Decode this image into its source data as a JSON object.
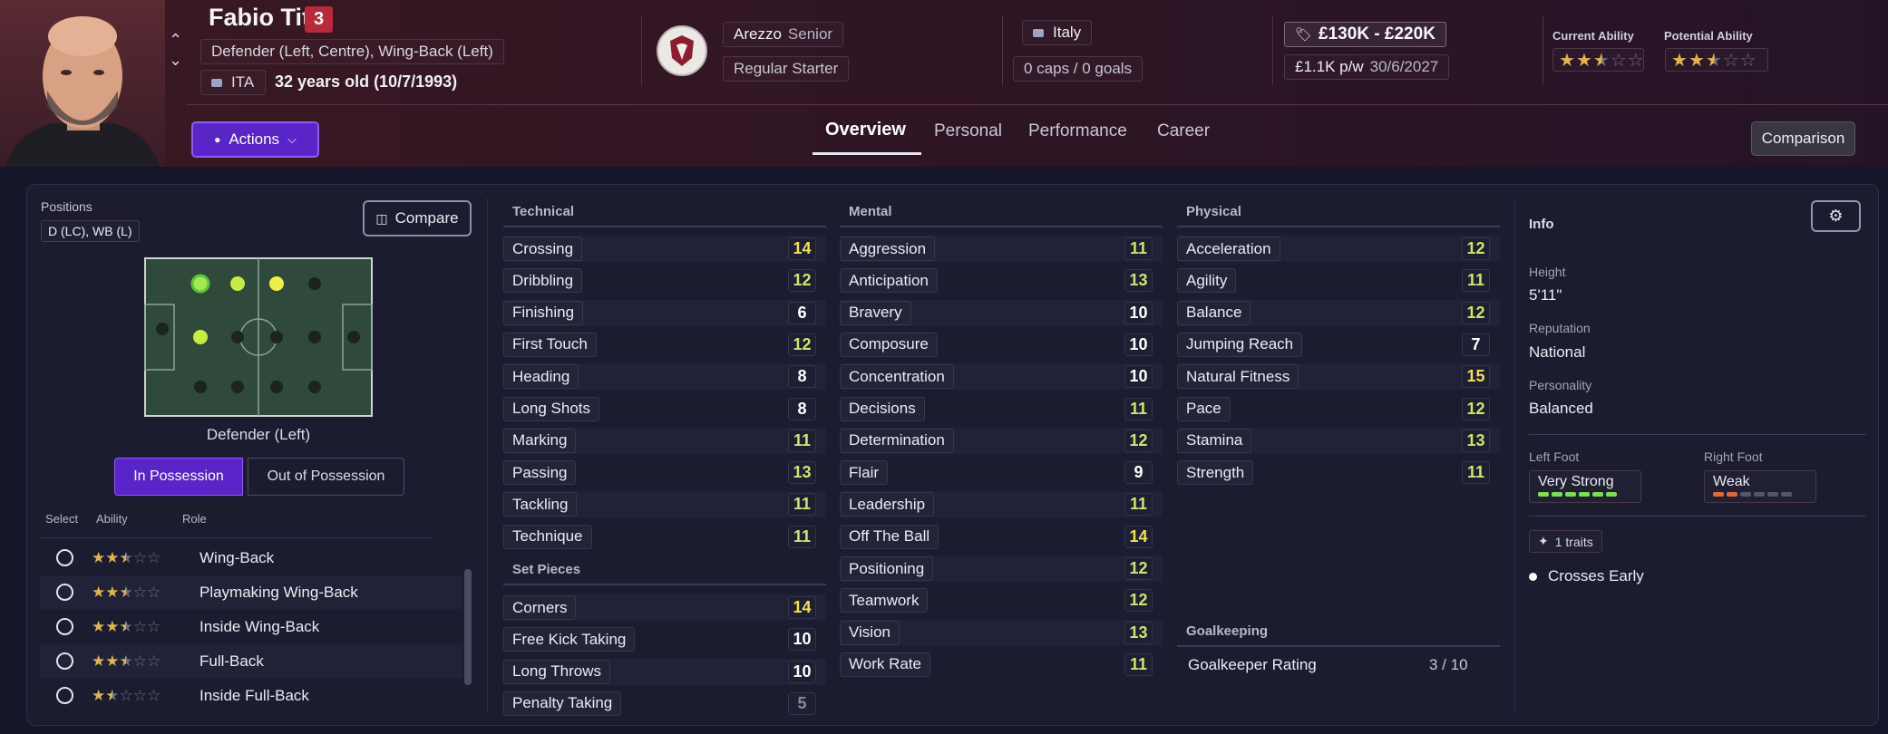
{
  "player": {
    "name": "Fabio Tito",
    "number": "3",
    "positions_text": "Defender (Left, Centre), Wing-Back (Left)",
    "nationality_code": "ITA",
    "age_text": "32 years old (10/7/1993)"
  },
  "club": {
    "name": "Arezzo",
    "squad": "Senior",
    "status": "Regular Starter",
    "badge_text": "S.S. AREZZO 1923"
  },
  "country": {
    "name": "Italy",
    "caps_text": "0 caps / 0 goals"
  },
  "value": {
    "range": "£130K - £220K",
    "wage": "£1.1K p/w",
    "contract_end": "30/6/2027"
  },
  "ability": {
    "current_label": "Current Ability",
    "current_stars": 2.5,
    "potential_label": "Potential Ability",
    "potential_stars": 2.5
  },
  "nav": {
    "actions_label": "Actions",
    "tabs": [
      "Overview",
      "Personal",
      "Performance",
      "Career"
    ],
    "active_tab": "Overview",
    "comparison_label": "Comparison"
  },
  "positions_panel": {
    "title": "Positions",
    "badge": "D (LC), WB (L)",
    "compare_label": "Compare",
    "pitch_caption": "Defender (Left)",
    "possession_tabs": [
      "In Possession",
      "Out of Possession"
    ],
    "active_possession": "In Possession",
    "role_headers": [
      "Select",
      "Ability",
      "Role"
    ],
    "roles": [
      {
        "name": "Wing-Back",
        "stars": 2.5
      },
      {
        "name": "Playmaking Wing-Back",
        "stars": 2.5
      },
      {
        "name": "Inside Wing-Back",
        "stars": 2.5
      },
      {
        "name": "Full-Back",
        "stars": 2.5
      },
      {
        "name": "Inside Full-Back",
        "stars": 2
      }
    ]
  },
  "attributes": {
    "technical": {
      "title": "Technical",
      "items": [
        {
          "name": "Crossing",
          "value": 14
        },
        {
          "name": "Dribbling",
          "value": 12
        },
        {
          "name": "Finishing",
          "value": 6
        },
        {
          "name": "First Touch",
          "value": 12
        },
        {
          "name": "Heading",
          "value": 8
        },
        {
          "name": "Long Shots",
          "value": 8
        },
        {
          "name": "Marking",
          "value": 11
        },
        {
          "name": "Passing",
          "value": 13
        },
        {
          "name": "Tackling",
          "value": 11
        },
        {
          "name": "Technique",
          "value": 11
        }
      ]
    },
    "set_pieces": {
      "title": "Set Pieces",
      "items": [
        {
          "name": "Corners",
          "value": 14
        },
        {
          "name": "Free Kick Taking",
          "value": 10
        },
        {
          "name": "Long Throws",
          "value": 10
        },
        {
          "name": "Penalty Taking",
          "value": 5
        }
      ]
    },
    "mental": {
      "title": "Mental",
      "items": [
        {
          "name": "Aggression",
          "value": 11
        },
        {
          "name": "Anticipation",
          "value": 13
        },
        {
          "name": "Bravery",
          "value": 10
        },
        {
          "name": "Composure",
          "value": 10
        },
        {
          "name": "Concentration",
          "value": 10
        },
        {
          "name": "Decisions",
          "value": 11
        },
        {
          "name": "Determination",
          "value": 12
        },
        {
          "name": "Flair",
          "value": 9
        },
        {
          "name": "Leadership",
          "value": 11
        },
        {
          "name": "Off The Ball",
          "value": 14
        },
        {
          "name": "Positioning",
          "value": 12
        },
        {
          "name": "Teamwork",
          "value": 12
        },
        {
          "name": "Vision",
          "value": 13
        },
        {
          "name": "Work Rate",
          "value": 11
        }
      ]
    },
    "physical": {
      "title": "Physical",
      "items": [
        {
          "name": "Acceleration",
          "value": 12
        },
        {
          "name": "Agility",
          "value": 11
        },
        {
          "name": "Balance",
          "value": 12
        },
        {
          "name": "Jumping Reach",
          "value": 7
        },
        {
          "name": "Natural Fitness",
          "value": 15
        },
        {
          "name": "Pace",
          "value": 12
        },
        {
          "name": "Stamina",
          "value": 13
        },
        {
          "name": "Strength",
          "value": 11
        }
      ]
    },
    "goalkeeping": {
      "title": "Goalkeeping",
      "rating_label": "Goalkeeper Rating",
      "rating_value": "3 / 10"
    }
  },
  "info": {
    "title": "Info",
    "height_label": "Height",
    "height": "5'11\"",
    "reputation_label": "Reputation",
    "reputation": "National",
    "personality_label": "Personality",
    "personality": "Balanced",
    "left_foot_label": "Left Foot",
    "left_foot": "Very Strong",
    "left_foot_level": 6,
    "right_foot_label": "Right Foot",
    "right_foot": "Weak",
    "right_foot_level": 2,
    "traits_badge": "1 traits",
    "traits": [
      "Crosses Early"
    ]
  },
  "colors": {
    "high": "#f2e24e",
    "good": "#c9e86a",
    "normal": "#ffffff",
    "low": "#8a8b98",
    "accent": "#6a2fd6",
    "foot_strong": "#7ddf4c",
    "foot_weak": "#e0673a"
  }
}
